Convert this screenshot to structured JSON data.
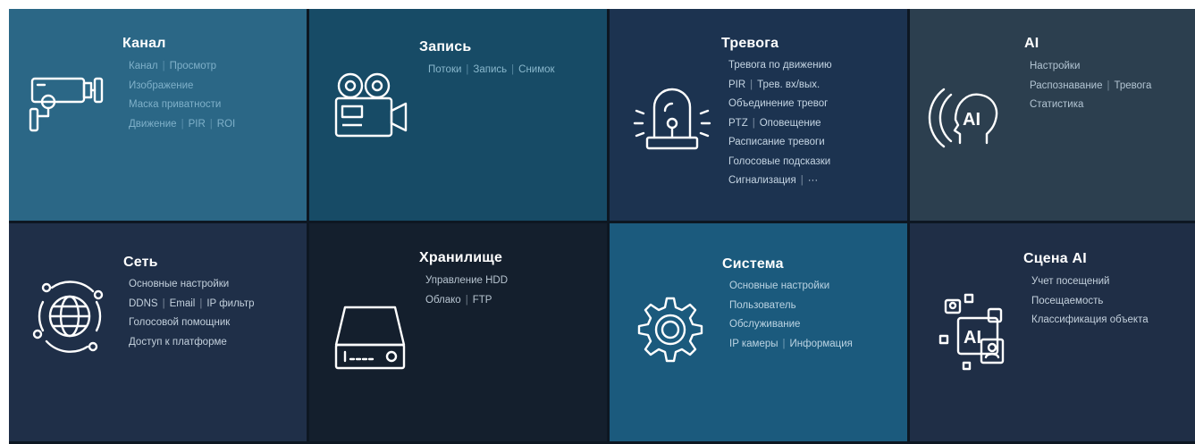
{
  "tiles": [
    {
      "id": "channel",
      "title": "Канал",
      "icon": "cctv-camera-icon",
      "bg": "#2b6786",
      "text_color": "#7fb0c9",
      "lines": [
        [
          "Канал",
          "Просмотр"
        ],
        [
          "Изображение"
        ],
        [
          "Маска приватности"
        ],
        [
          "Движение",
          "PIR",
          "ROI"
        ]
      ]
    },
    {
      "id": "record",
      "title": "Запись",
      "icon": "film-camera-icon",
      "bg": "#174b66",
      "text_color": "#89b7cc",
      "lines": [
        [
          "Потоки",
          "Запись",
          "Снимок"
        ]
      ]
    },
    {
      "id": "alarm",
      "title": "Тревога",
      "icon": "alarm-beacon-icon",
      "bg": "#1c3350",
      "text_color": "#c5d5e3",
      "lines": [
        [
          "Тревога по движению"
        ],
        [
          "PIR",
          "Трев. вх/вых."
        ],
        [
          "Объединение тревог"
        ],
        [
          "PTZ",
          "Оповещение"
        ],
        [
          "Расписание тревоги"
        ],
        [
          "Голосовые подсказки"
        ],
        [
          "Сигнализация",
          "···"
        ]
      ]
    },
    {
      "id": "ai",
      "title": "AI",
      "icon": "ai-head-icon",
      "bg": "#2c3f4f",
      "text_color": "#b3c5d3",
      "lines": [
        [
          "Настройки"
        ],
        [
          "Распознавание",
          "Тревога"
        ],
        [
          "Статистика"
        ]
      ]
    },
    {
      "id": "network",
      "title": "Сеть",
      "icon": "globe-network-icon",
      "bg": "#1f2f48",
      "text_color": "#c3d0dc",
      "lines": [
        [
          "Основные настройки"
        ],
        [
          "DDNS",
          "Email",
          "IP фильтр"
        ],
        [
          "Голосовой помощник"
        ],
        [
          "Доступ к платформе"
        ]
      ]
    },
    {
      "id": "storage",
      "title": "Хранилище",
      "icon": "hdd-device-icon",
      "bg": "#141f2d",
      "text_color": "#b7c4d0",
      "lines": [
        [
          "Управление HDD"
        ],
        [
          "Облако",
          "FTP"
        ]
      ]
    },
    {
      "id": "system",
      "title": "Система",
      "icon": "gear-icon",
      "bg": "#1b5a7d",
      "text_color": "#bcd4e3",
      "lines": [
        [
          "Основные настройки"
        ],
        [
          "Пользователь"
        ],
        [
          "Обслуживание"
        ],
        [
          "IP камеры",
          "Информация"
        ]
      ]
    },
    {
      "id": "ai-scene",
      "title": "Сцена AI",
      "icon": "ai-scene-icon",
      "bg": "#1f2e46",
      "text_color": "#c3d0dc",
      "lines": [
        [
          "Учет посещений"
        ],
        [
          "Посещаемость"
        ],
        [
          "Классификация объекта"
        ]
      ]
    }
  ]
}
